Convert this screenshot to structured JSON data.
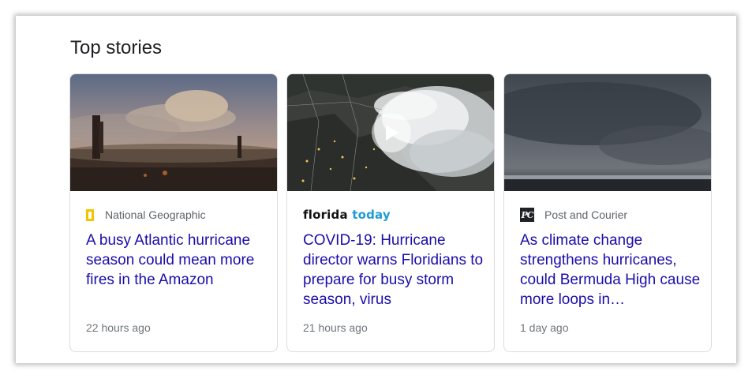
{
  "section": {
    "title": "Top stories"
  },
  "cards": [
    {
      "source": "National Geographic",
      "headline": "A busy Atlantic hurricane season could mean more fires in the Amazon",
      "time": "22 hours ago",
      "image": "burned-forest-photo"
    },
    {
      "source_part1": "florida",
      "source_part2": "today",
      "headline": "COVID-19: Hurricane director warns Floridians to prepare for busy storm season, virus",
      "time": "21 hours ago",
      "image": "hurricane-satellite-map",
      "has_video": true,
      "play_icon": "play-icon"
    },
    {
      "source_logo_text": "PC",
      "source": "Post and Courier",
      "headline": "As climate change strengthens hurricanes, could Bermuda High cause more loops in…",
      "time": "1 day ago",
      "image": "storm-over-sea-photo"
    }
  ],
  "colors": {
    "link": "#1a0dab",
    "heading": "#202124",
    "meta": "#70757a",
    "natgeo_yellow": "#f5c400",
    "florida_today_blue": "#1e9bd7"
  }
}
